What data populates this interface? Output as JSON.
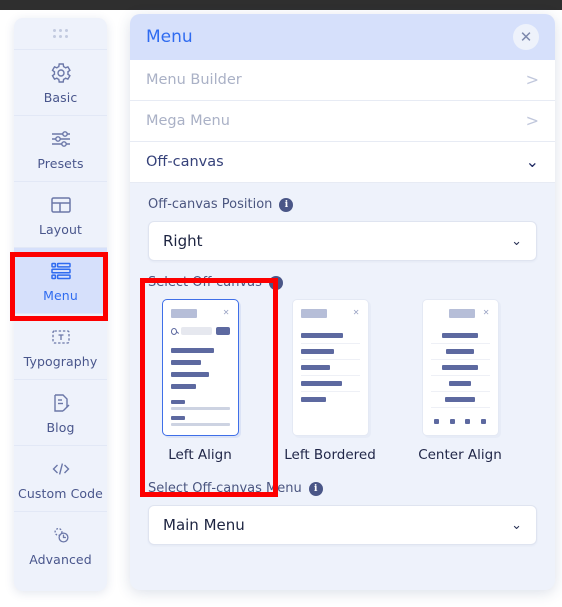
{
  "sidebar": {
    "grip": "drag-handle-dots",
    "items": [
      {
        "label": "Basic",
        "icon": "gear-icon",
        "active": false
      },
      {
        "label": "Presets",
        "icon": "sliders-icon",
        "active": false
      },
      {
        "label": "Layout",
        "icon": "layout-icon",
        "active": false
      },
      {
        "label": "Menu",
        "icon": "menu-list-icon",
        "active": true
      },
      {
        "label": "Typography",
        "icon": "text-box-icon",
        "active": false
      },
      {
        "label": "Blog",
        "icon": "document-edit-icon",
        "active": false
      },
      {
        "label": "Custom Code",
        "icon": "code-brackets-icon",
        "active": false
      },
      {
        "label": "Advanced",
        "icon": "advanced-gear-icon",
        "active": false
      }
    ]
  },
  "panel": {
    "title": "Menu",
    "close_label": "✕",
    "accordion": [
      {
        "label": "Menu Builder",
        "chevron": ">",
        "open": false
      },
      {
        "label": "Mega Menu",
        "chevron": ">",
        "open": false
      },
      {
        "label": "Off-canvas",
        "chevron": "⌄",
        "open": true
      }
    ],
    "position_field": {
      "label": "Off-canvas Position",
      "info": "i",
      "value": "Right",
      "chevron": "⌄"
    },
    "offcanvas_field": {
      "label": "Select Off-canvas",
      "info": "i",
      "options": [
        {
          "label": "Left Align",
          "selected": true
        },
        {
          "label": "Left Bordered",
          "selected": false
        },
        {
          "label": "Center Align",
          "selected": false
        }
      ]
    },
    "menu_field": {
      "label": "Select Off-canvas Menu",
      "info": "i",
      "value": "Main Menu",
      "chevron": "⌄"
    }
  },
  "highlights": {
    "color": "#fd0000",
    "boxes": [
      "sidebar-menu-item",
      "select-offcanvas-group"
    ]
  }
}
